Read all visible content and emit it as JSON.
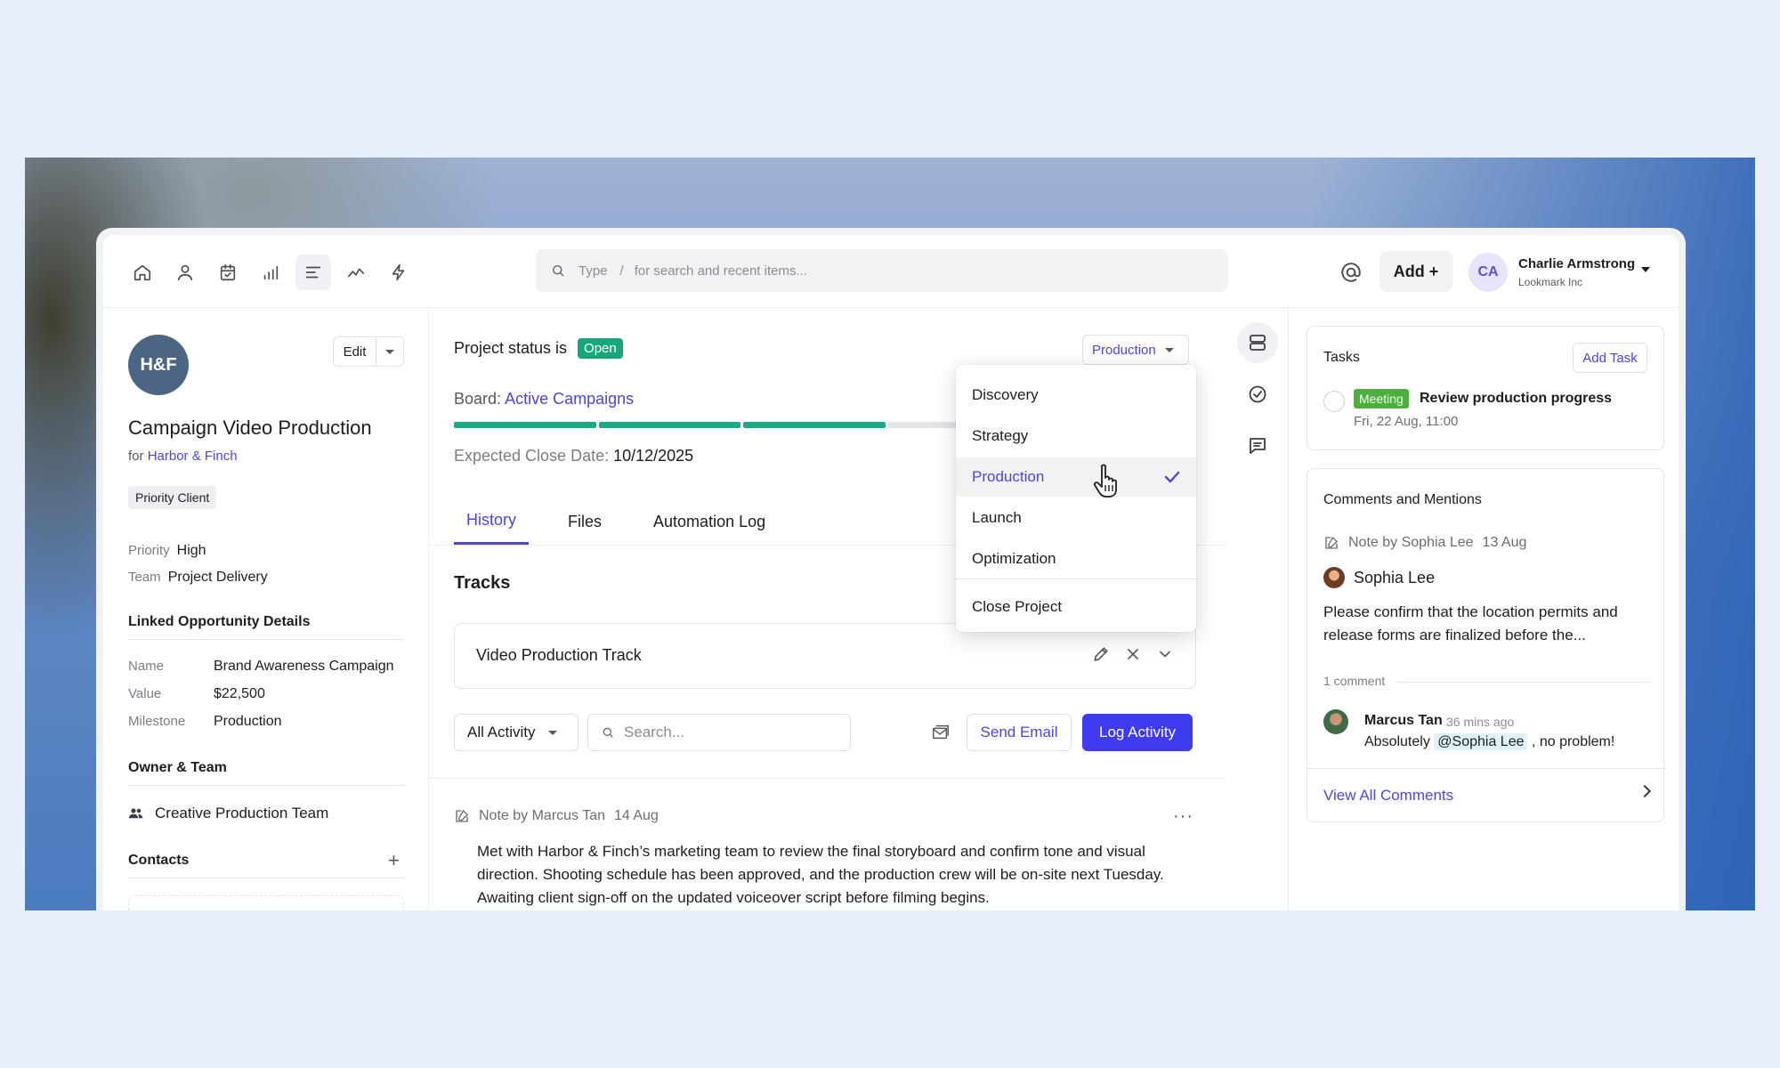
{
  "nav": {
    "icons": [
      "home-icon",
      "person-icon",
      "calendar-icon",
      "bar-chart-icon",
      "list-icon",
      "trend-icon",
      "lightning-icon"
    ],
    "active_index": 4
  },
  "search": {
    "type_label": "Type",
    "slash": "/",
    "hint": "for search and recent items..."
  },
  "header": {
    "add_label": "Add +",
    "user_initials": "CA",
    "user_name": "Charlie Armstrong",
    "user_org": "Lookmark Inc"
  },
  "left": {
    "logo_text": "H&F",
    "edit_label": "Edit",
    "title": "Campaign Video Production",
    "for_prefix": "for",
    "client": "Harbor & Finch",
    "tag": "Priority Client",
    "priority_label": "Priority",
    "priority_value": "High",
    "team_label": "Team",
    "team_value": "Project Delivery",
    "linked_heading": "Linked Opportunity Details",
    "details": [
      {
        "label": "Name",
        "value": "Brand Awareness Campaign"
      },
      {
        "label": "Value",
        "value": "$22,500"
      },
      {
        "label": "Milestone",
        "value": "Production"
      }
    ],
    "owner_heading": "Owner & Team",
    "team_name": "Creative Production Team",
    "contacts_heading": "Contacts",
    "contacts_add": "+"
  },
  "center": {
    "status_prefix": "Project status is",
    "status_badge": "Open",
    "stage_select": "Production",
    "board_prefix": "Board:",
    "board_link": "Active Campaigns",
    "progress": {
      "completed": 3,
      "total": 5
    },
    "close_date_label": "Expected Close Date:",
    "close_date_value": "10/12/2025",
    "tabs": [
      {
        "label": "History",
        "active": true
      },
      {
        "label": "Files",
        "active": false
      },
      {
        "label": "Automation Log",
        "active": false
      }
    ],
    "tracks_heading": "Tracks",
    "track_name": "Video Production Track",
    "activity_filter": "All Activity",
    "activity_search_placeholder": "Search...",
    "send_email": "Send Email",
    "log_activity": "Log Activity",
    "note_author": "Note by Marcus Tan",
    "note_date": "14 Aug",
    "note_more": "···",
    "note_body": "Met with Harbor & Finch’s marketing team to review the final storyboard and confirm tone and visual direction. Shooting schedule has been approved, and the production crew will be on-site next Tuesday. Awaiting client sign-off on the updated voiceover script before filming begins."
  },
  "dropdown": {
    "items": [
      "Discovery",
      "Strategy",
      "Production",
      "Launch",
      "Optimization"
    ],
    "selected": "Production",
    "close_item": "Close Project"
  },
  "right": {
    "tasks_title": "Tasks",
    "add_task": "Add Task",
    "task_badge": "Meeting",
    "task_title": "Review production progress",
    "task_date": "Fri, 22 Aug, 11:00",
    "comments_title": "Comments and Mentions",
    "note_by": "Note by Sophia Lee",
    "note_date": "13 Aug",
    "author": "Sophia Lee",
    "body": "Please confirm that the location permits and release forms are finalized before the...",
    "comment_count": "1 comment",
    "reply_name": "Marcus Tan",
    "reply_time": "36 mins ago",
    "reply_prefix": "Absolutely",
    "reply_mention": "@Sophia Lee",
    "reply_suffix": ", no problem!",
    "view_all": "View All Comments"
  },
  "colors": {
    "accent": "#4b47d8",
    "primary_button": "#3f3cf0",
    "open_badge": "#17a57e",
    "progress_done": "#1aa989",
    "meeting_badge": "#4caf3e"
  }
}
